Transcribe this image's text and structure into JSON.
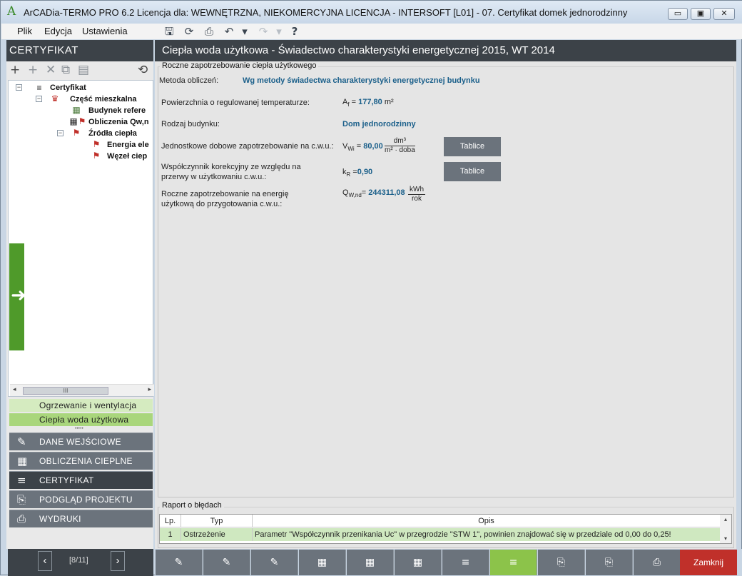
{
  "app": {
    "title": "ArCADia-TERMO PRO 6.2 Licencja dla: WEWNĘTRZNA, NIEKOMERCYJNA LICENCJA - INTERSOFT [L01] - 07. Certyfikat domek jednorodzinny",
    "logo_glyph": "A"
  },
  "window_controls": {
    "minimize": "▭",
    "restore": "▣",
    "close": "✕"
  },
  "menu": [
    "Plik",
    "Edycja",
    "Ustawienia"
  ],
  "toolbar_icons": [
    "save-icon",
    "refresh-icon",
    "preview-icon",
    "undo-icon",
    "undo-dropdown-icon",
    "redo-icon",
    "redo-dropdown-icon",
    "help-icon"
  ],
  "toolbar_glyphs": {
    "save": "🖫",
    "refresh": "⟳",
    "preview": "⎙",
    "undo": "↶",
    "undo_dd": "▾",
    "redo": "↷",
    "redo_dd": "▾",
    "help": "?"
  },
  "left_header": "CERTYFIKAT",
  "tree_toolbar_glyphs": {
    "add": "+",
    "add2": "+",
    "remove": "✕",
    "copy": "⧉",
    "paste": "▤",
    "sync": "⟲"
  },
  "tree": {
    "root": "Certyfikat",
    "part": "Część mieszkalna",
    "building": "Budynek refere",
    "calc": "Obliczenia Qw,n",
    "sources": "Źródła ciepła",
    "energy": "Energia ele",
    "node": "Węzeł ciep"
  },
  "scroll_thumb": "III",
  "submenu": [
    "Ogrzewanie i wentylacja",
    "Ciepła woda użytkowa"
  ],
  "submenu_dots": "•••••",
  "nav": [
    {
      "label": "DANE WEJŚCIOWE",
      "icon": "input-data-icon",
      "glyph": "✎"
    },
    {
      "label": "OBLICZENIA CIEPLNE",
      "icon": "calculator-icon",
      "glyph": "▦"
    },
    {
      "label": "CERTYFIKAT",
      "icon": "certificate-icon",
      "glyph": "≡"
    },
    {
      "label": "PODGLĄD PROJEKTU",
      "icon": "preview-icon",
      "glyph": "⎘"
    },
    {
      "label": "WYDRUKI",
      "icon": "printer-icon",
      "glyph": "⎙"
    }
  ],
  "pager": {
    "prev": "‹",
    "next": "›",
    "text": "[8/11]"
  },
  "main": {
    "header": "Ciepła woda użytkowa - Świadectwo charakterystyki energetycznej 2015, WT 2014",
    "section_title": "Roczne zapotrzebowanie ciepła użytkowego",
    "method_label": "Metoda obliczeń:",
    "method_value": "Wg metody świadectwa charakterystyki energetycznej budynku",
    "area_label": "Powierzchnia o regulowanej temperaturze:",
    "area_sym": "A",
    "area_sub": "f",
    "area_value": "177,80",
    "area_unit": "m²",
    "building_type_label": "Rodzaj budynku:",
    "building_type_value": "Dom jednorodzinny",
    "daily_label": "Jednostkowe dobowe zapotrzebowanie na c.w.u.:",
    "daily_sym": "V",
    "daily_sub": "Wi",
    "daily_value": "80,00",
    "daily_unit_num": "dm³",
    "daily_unit_den": "m² · doba",
    "tables_button": "Tablice",
    "corr_label_1": "Współczynnik korekcyjny ze względu na",
    "corr_label_2": "przerwy w użytkowaniu c.w.u.:",
    "corr_sym": "k",
    "corr_sub": "R",
    "corr_value": "0,90",
    "annual_label_1": "Roczne zapotrzebowanie na energię",
    "annual_label_2": "użytkową do przygotowania c.w.u.:",
    "annual_sym": "Q",
    "annual_sub": "W,nd",
    "annual_value": "244311,08",
    "annual_unit_num": "kWh",
    "annual_unit_den": "rok"
  },
  "errors": {
    "title": "Raport o błędach",
    "columns": [
      "Lp.",
      "Typ",
      "Opis"
    ],
    "rows": [
      {
        "lp": "1",
        "type": "Ostrzeżenie",
        "desc": "Parametr \"Współczynnik przenikania Uc\" w przegrodzie \"STW 1\", powinien znajdować się w przedziale od 0,00 do 0,25!"
      }
    ]
  },
  "bottom_bar": {
    "buttons": [
      "input-data-icon",
      "input-data-icon",
      "input-data-icon",
      "calculator-icon",
      "calculator-icon",
      "calculator-icon",
      "certificate-icon",
      "certificate-icon",
      "preview-icon",
      "preview-icon",
      "printer-icon"
    ],
    "close": "Zamknij"
  },
  "colors": {
    "accent": "#8cc34a",
    "dark": "#3c4248",
    "close": "#c0302a",
    "value": "#1a5f8a"
  }
}
